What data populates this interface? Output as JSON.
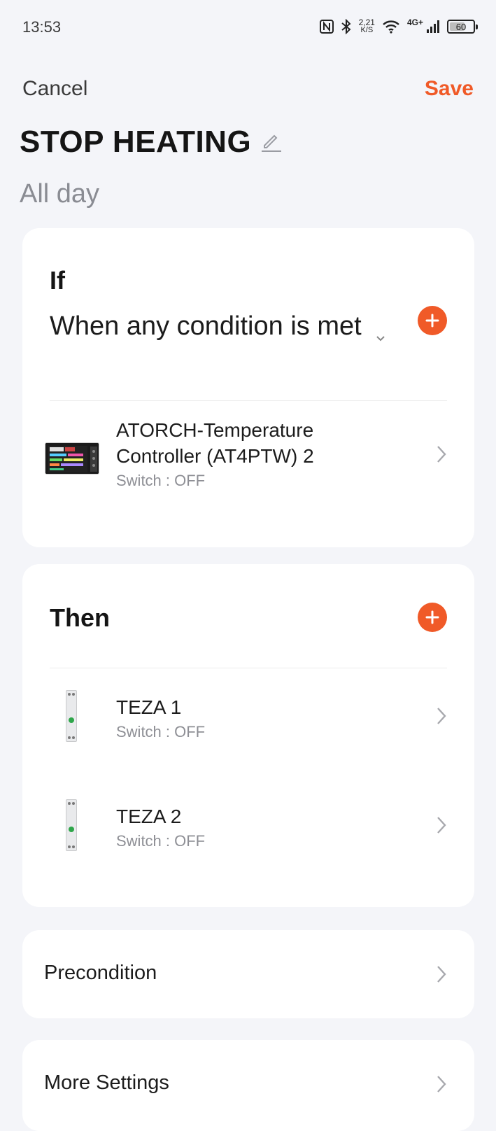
{
  "status_bar": {
    "time": "13:53",
    "speed_value": "2,21",
    "speed_unit": "K/S",
    "network": "4G+",
    "battery": "60"
  },
  "header": {
    "cancel_label": "Cancel",
    "save_label": "Save",
    "title": "STOP HEATING",
    "subtitle": "All day"
  },
  "if_section": {
    "heading": "If",
    "condition_mode": "When any condition is met",
    "conditions": [
      {
        "name": "ATORCH-Temperature Controller (AT4PTW) 2",
        "status": "Switch : OFF"
      }
    ]
  },
  "then_section": {
    "heading": "Then",
    "actions": [
      {
        "name": "TEZA 1",
        "status": "Switch : OFF"
      },
      {
        "name": "TEZA 2",
        "status": "Switch : OFF"
      }
    ]
  },
  "rows": {
    "precondition_label": "Precondition",
    "more_settings_label": "More Settings"
  },
  "colors": {
    "accent": "#f05a28",
    "background": "#f4f5f9",
    "card": "#ffffff",
    "secondary_text": "#8e8f95"
  },
  "icons": [
    "nfc-icon",
    "bluetooth-icon",
    "wifi-icon",
    "signal-icon",
    "battery-icon",
    "edit-icon",
    "chevron-down-icon",
    "plus-icon",
    "chevron-right-icon"
  ]
}
